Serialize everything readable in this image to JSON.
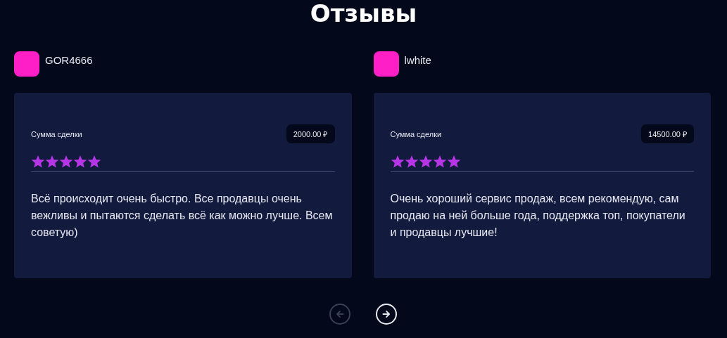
{
  "title": "Отзывы",
  "reviews": [
    {
      "user": "GOR4666",
      "amount_label": "Сумма сделки",
      "amount": "2000.00 ₽",
      "stars": 5,
      "text": "Всё происходит очень быстро. Все продавцы очень вежливы и пытаются сделать всё как можно лучше. Всем советую)"
    },
    {
      "user": "lwhite",
      "amount_label": "Сумма сделки",
      "amount": "14500.00 ₽",
      "stars": 5,
      "text": "Очень хороший сервис продаж, всем рекомендую, сам продаю на ней больше года, поддержка топ, покупатели и продавцы лучшие!"
    }
  ],
  "nav": [
    {
      "kind": "prev",
      "disabled": true
    },
    {
      "kind": "next",
      "disabled": false
    }
  ]
}
